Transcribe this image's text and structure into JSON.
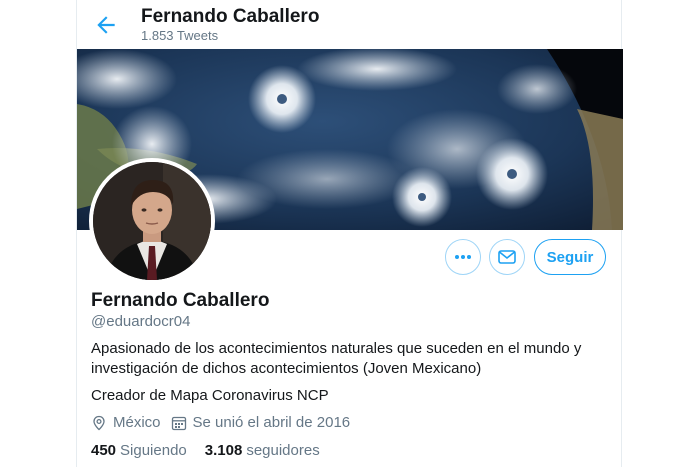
{
  "header": {
    "name": "Fernando Caballero",
    "tweet_count": "1.853 Tweets"
  },
  "profile": {
    "name": "Fernando Caballero",
    "handle": "@eduardocr04",
    "bio_line1": "Apasionado de los acontecimientos naturales que suceden en el mundo y investigación de dichos acontecimientos (Joven Mexicano)",
    "bio_line2": "Creador de Mapa Coronavirus NCP",
    "location": "México",
    "joined": "Se unió el abril de 2016"
  },
  "actions": {
    "follow_label": "Seguir"
  },
  "stats": {
    "following_count": "450",
    "following_label": "Siguiendo",
    "followers_count": "3.108",
    "followers_label": "seguidores"
  },
  "icons": {
    "back": "arrow-left-icon",
    "more": "more-dots-icon",
    "mail": "envelope-icon",
    "location": "location-pin-icon",
    "calendar": "calendar-icon"
  },
  "colors": {
    "accent": "#1da1f2",
    "muted": "#657786",
    "text": "#14171a"
  }
}
